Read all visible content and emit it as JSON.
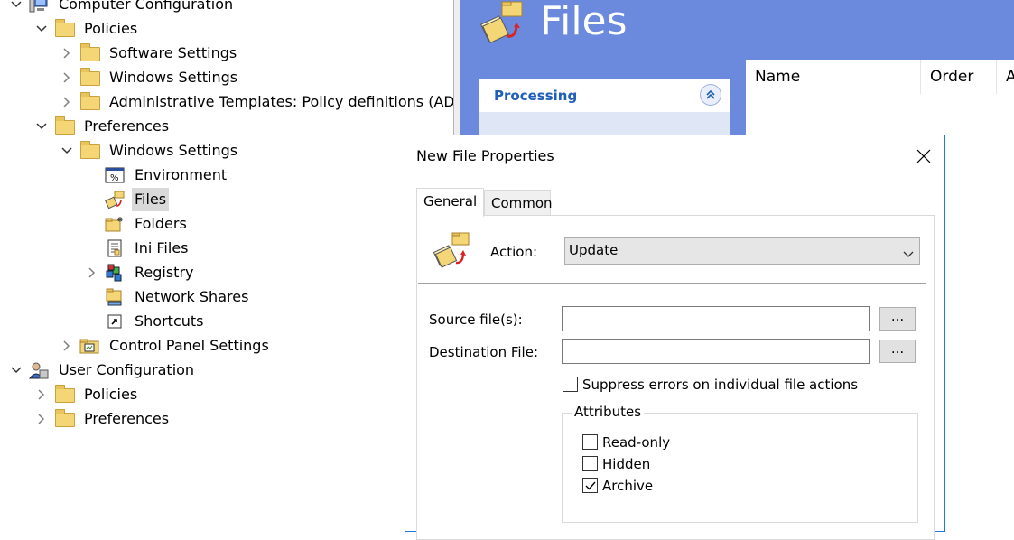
{
  "tree": {
    "items": [
      {
        "label": "Computer Configuration",
        "expander": "expanded",
        "icon": "computer-icon",
        "selected": false
      },
      {
        "label": "Policies",
        "expander": "expanded",
        "icon": "folder-icon",
        "selected": false
      },
      {
        "label": "Software Settings",
        "expander": "collapsed",
        "icon": "folder-icon",
        "selected": false
      },
      {
        "label": "Windows Settings",
        "expander": "collapsed",
        "icon": "folder-icon",
        "selected": false
      },
      {
        "label": "Administrative Templates: Policy definitions (AD",
        "expander": "collapsed",
        "icon": "folder-icon",
        "selected": false
      },
      {
        "label": "Preferences",
        "expander": "expanded",
        "icon": "folder-icon",
        "selected": false
      },
      {
        "label": "Windows Settings",
        "expander": "expanded",
        "icon": "folder-icon",
        "selected": false
      },
      {
        "label": "Environment",
        "expander": "none",
        "icon": "environment-icon",
        "selected": false
      },
      {
        "label": "Files",
        "expander": "none",
        "icon": "files-icon",
        "selected": true
      },
      {
        "label": "Folders",
        "expander": "none",
        "icon": "folders-icon",
        "selected": false
      },
      {
        "label": "Ini Files",
        "expander": "none",
        "icon": "ini-file-icon",
        "selected": false
      },
      {
        "label": "Registry",
        "expander": "collapsed",
        "icon": "registry-icon",
        "selected": false
      },
      {
        "label": "Network Shares",
        "expander": "none",
        "icon": "network-share-icon",
        "selected": false
      },
      {
        "label": "Shortcuts",
        "expander": "none",
        "icon": "shortcut-icon",
        "selected": false
      },
      {
        "label": "Control Panel Settings",
        "expander": "collapsed",
        "icon": "control-panel-folder-icon",
        "selected": false
      },
      {
        "label": "User Configuration",
        "expander": "expanded",
        "icon": "user-icon",
        "selected": false
      },
      {
        "label": "Policies",
        "expander": "collapsed",
        "icon": "folder-icon",
        "selected": false
      },
      {
        "label": "Preferences",
        "expander": "collapsed",
        "icon": "folder-icon",
        "selected": false
      }
    ]
  },
  "right_pane": {
    "title": "Files",
    "processing_label": "Processing",
    "columns": [
      "Name",
      "Order",
      "A"
    ]
  },
  "dialog": {
    "title": "New File Properties",
    "tabs": [
      {
        "label": "General",
        "active": true
      },
      {
        "label": "Common",
        "active": false
      }
    ],
    "action_label": "Action:",
    "action_value": "Update",
    "source_label": "Source file(s):",
    "source_value": "",
    "source_browse": "...",
    "dest_label": "Destination File:",
    "dest_value": "",
    "dest_browse": "...",
    "suppress_label": "Suppress errors on individual file actions",
    "suppress_checked": false,
    "attributes_legend": "Attributes",
    "attributes": [
      {
        "label": "Read-only",
        "checked": false
      },
      {
        "label": "Hidden",
        "checked": false
      },
      {
        "label": "Archive",
        "checked": true
      }
    ]
  },
  "colors": {
    "right_pane_bg": "#6b8ade",
    "processing_text": "#1f5fb8",
    "dialog_border": "#1e7ad6",
    "selection": "#d9d9d9"
  }
}
